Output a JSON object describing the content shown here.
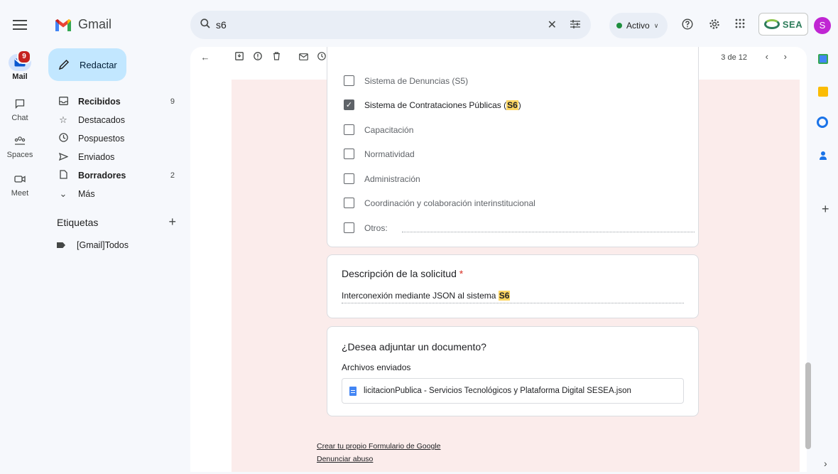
{
  "rail": {
    "mail_label": "Mail",
    "mail_badge": "9",
    "chat_label": "Chat",
    "spaces_label": "Spaces",
    "meet_label": "Meet"
  },
  "logo": {
    "text": "Gmail"
  },
  "compose": {
    "label": "Redactar"
  },
  "nav": {
    "items": [
      {
        "label": "Recibidos",
        "count": "9",
        "icon": "inbox-icon"
      },
      {
        "label": "Destacados",
        "count": "",
        "icon": "star-icon"
      },
      {
        "label": "Pospuestos",
        "count": "",
        "icon": "clock-icon"
      },
      {
        "label": "Enviados",
        "count": "",
        "icon": "send-icon"
      },
      {
        "label": "Borradores",
        "count": "2",
        "icon": "draft-icon"
      },
      {
        "label": "Más",
        "count": "",
        "icon": "chevron-down-icon"
      }
    ]
  },
  "labels": {
    "heading": "Etiquetas",
    "items": [
      {
        "label": "[Gmail]Todos"
      }
    ]
  },
  "search": {
    "value": "s6"
  },
  "status": {
    "label": "Activo"
  },
  "org_logo": {
    "text": "SEA"
  },
  "avatar": {
    "initial": "S"
  },
  "pager": {
    "text": "3 de 12"
  },
  "form": {
    "options": [
      {
        "label": "Sistema de Denuncias (S5)",
        "checked": false
      },
      {
        "label_before": "Sistema de Contrataciones Públicas (",
        "label_hl": "S6",
        "label_after": ")",
        "checked": true
      },
      {
        "label": "Capacitación",
        "checked": false
      },
      {
        "label": "Normatividad",
        "checked": false
      },
      {
        "label": "Administración",
        "checked": false
      },
      {
        "label": "Coordinación y colaboración interinstitucional",
        "checked": false
      },
      {
        "label": "Otros:",
        "checked": false
      }
    ],
    "description": {
      "title": "Descripción de la solicitud",
      "required_mark": "*",
      "answer_before": "Interconexión mediante JSON al sistema ",
      "answer_hl": "S6"
    },
    "attachment": {
      "title": "¿Desea adjuntar un documento?",
      "subtitle": "Archivos enviados",
      "file_name": "licitacionPublica - Servicios Tecnológicos y Plataforma Digital SESEA.json"
    },
    "footer": {
      "create_link": "Crear tu propio Formulario de Google",
      "report_link": "Denunciar abuso"
    }
  },
  "colors": {
    "accent_compose": "#c2e7ff",
    "form_background": "#fbeceb",
    "highlight": "#fdd663",
    "avatar": "#c026d3",
    "badge": "#c5221f"
  }
}
